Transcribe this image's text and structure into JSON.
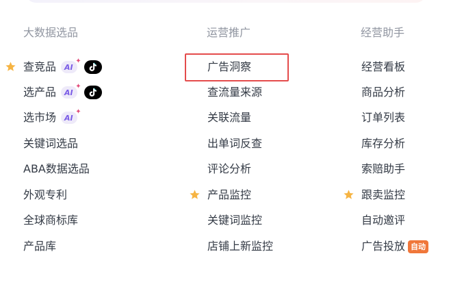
{
  "columns": [
    {
      "heading": "大数据选品",
      "items": [
        {
          "label": "查竞品",
          "starred": true,
          "ai": true,
          "tiktok": true
        },
        {
          "label": "选产品",
          "starred": false,
          "ai": true,
          "tiktok": true
        },
        {
          "label": "选市场",
          "starred": false,
          "ai": true,
          "tiktok": false
        },
        {
          "label": "关键词选品"
        },
        {
          "label": "ABA数据选品"
        },
        {
          "label": "外观专利"
        },
        {
          "label": "全球商标库"
        },
        {
          "label": "产品库"
        }
      ]
    },
    {
      "heading": "运营推广",
      "items": [
        {
          "label": "广告洞察",
          "highlighted": true
        },
        {
          "label": "查流量来源"
        },
        {
          "label": "关联流量"
        },
        {
          "label": "出单词反查"
        },
        {
          "label": "评论分析"
        },
        {
          "label": "产品监控",
          "starred": true
        },
        {
          "label": "关键词监控"
        },
        {
          "label": "店铺上新监控"
        }
      ]
    },
    {
      "heading": "经营助手",
      "items": [
        {
          "label": "经营看板"
        },
        {
          "label": "商品分析"
        },
        {
          "label": "订单列表"
        },
        {
          "label": "库存分析"
        },
        {
          "label": "索赔助手"
        },
        {
          "label": "跟卖监控",
          "starred": true
        },
        {
          "label": "自动邀评"
        },
        {
          "label": "广告投放",
          "badge": "自动"
        }
      ]
    }
  ],
  "badges": {
    "ai_label": "AI",
    "ai_spark": "✦"
  },
  "icons": {
    "star": "star-icon",
    "tiktok": "tiktok-icon"
  },
  "colors": {
    "heading": "#9196a1",
    "item_text": "#333a45",
    "star": "#f6b443",
    "ai_badge_bg": "#eeeaf9",
    "ai_badge_text": "#7a5ce6",
    "highlight_border": "#e44b4b",
    "auto_badge_bg": "#f0773a"
  }
}
